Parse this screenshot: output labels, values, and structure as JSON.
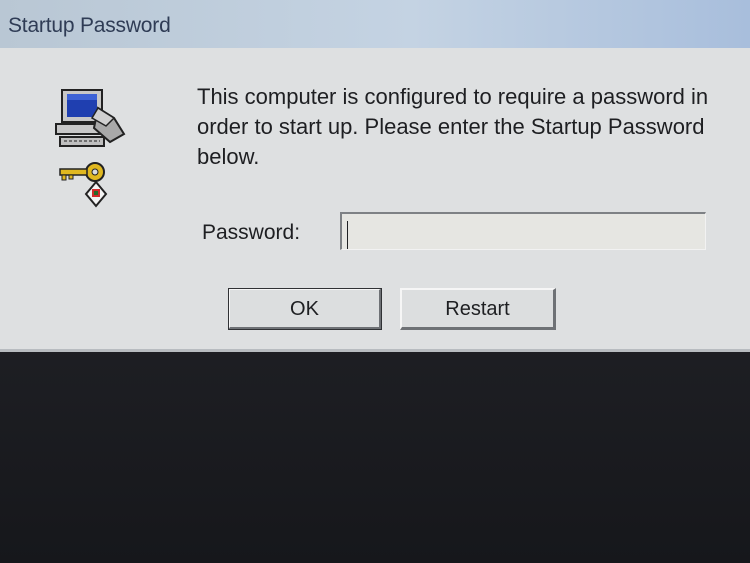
{
  "window": {
    "title": "Startup Password"
  },
  "dialog": {
    "message": "This computer is configured to require a password in order to start up. Please enter the Startup Password below.",
    "password_label": "Password:",
    "password_value": "",
    "ok_label": "OK",
    "restart_label": "Restart"
  },
  "icons": {
    "main": "computer-with-key-icon"
  },
  "colors": {
    "titlebar": "#c4d3e3",
    "dialog_bg": "#dee0e1",
    "text": "#1e1f22"
  }
}
